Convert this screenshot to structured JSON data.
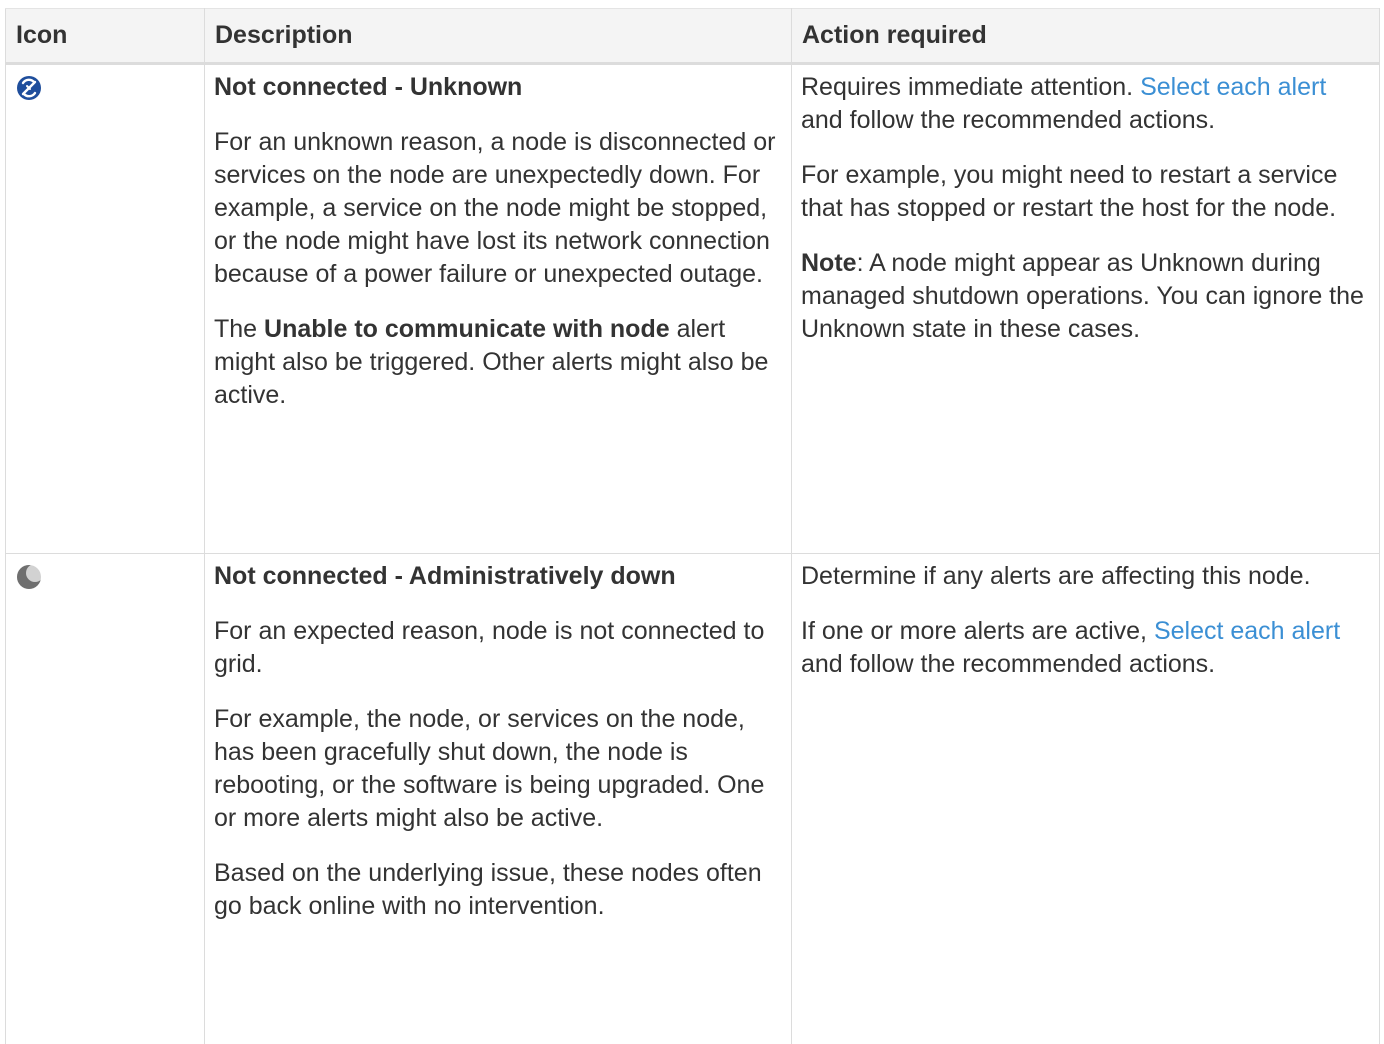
{
  "table": {
    "headers": {
      "icon": "Icon",
      "description": "Description",
      "action": "Action required"
    },
    "rows": [
      {
        "icon": "unknown-disconnected-icon",
        "icon_color": "#1f4e9c",
        "title": "Not connected - Unknown",
        "desc_p1": "For an unknown reason, a node is disconnected or services on the node are unexpectedly down. For example, a service on the node might be stopped, or the node might have lost its network connection because of a power failure or unexpected outage.",
        "desc_p2_pre": "The ",
        "desc_p2_bold": "Unable to communicate with node",
        "desc_p2_post": " alert might also be triggered. Other alerts might also be active.",
        "action_p1_pre": "Requires immediate attention. ",
        "action_p1_link": "Select each alert",
        "action_p1_post": " and follow the recommended actions.",
        "action_p2": "For example, you might need to restart a service that has stopped or restart the host for the node.",
        "action_p3_bold": "Note",
        "action_p3_post": ": A node might appear as Unknown during managed shutdown operations. You can ignore the Unknown state in these cases."
      },
      {
        "icon": "admin-down-moon-icon",
        "icon_color": "#7d7d7d",
        "title": "Not connected - Administratively down",
        "desc_p1": "For an expected reason, node is not connected to grid.",
        "desc_p2": "For example, the node, or services on the node, has been gracefully shut down, the node is rebooting, or the software is being upgraded. One or more alerts might also be active.",
        "desc_p3": "Based on the underlying issue, these nodes often go back online with no intervention.",
        "action_p1": "Determine if any alerts are affecting this node.",
        "action_p2_pre": "If one or more alerts are active, ",
        "action_p2_link": "Select each alert",
        "action_p2_post": " and follow the recommended actions."
      }
    ]
  },
  "colors": {
    "link": "#3b8fd4",
    "text": "#333333",
    "header_bg": "#f4f4f4",
    "border": "#dcdcdc"
  }
}
